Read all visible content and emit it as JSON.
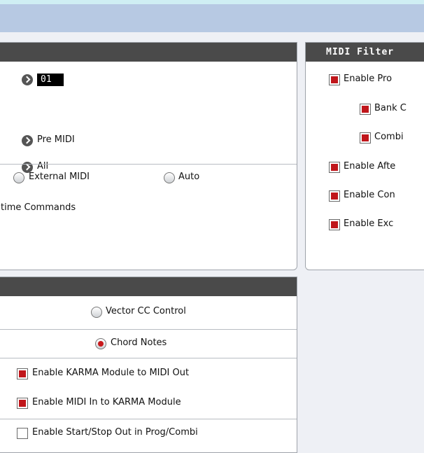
{
  "left_top_panel": {
    "channel_value": "01",
    "pre_midi_label": "Pre MIDI",
    "all_label": "All",
    "external_midi_label": "External MIDI",
    "auto_label": "Auto",
    "realtime_label": "time Commands"
  },
  "midi_filter": {
    "title": "MIDI Filter",
    "items": [
      {
        "label": "Enable Pro",
        "checked": true
      },
      {
        "label": "Bank C",
        "checked": true
      },
      {
        "label": "Combi",
        "checked": true
      },
      {
        "label": "Enable Afte",
        "checked": true
      },
      {
        "label": "Enable Con",
        "checked": true
      },
      {
        "label": "Enable Exc",
        "checked": true
      }
    ]
  },
  "karma_panel": {
    "vector_cc_label": "Vector CC Control",
    "chord_notes_label": "Chord Notes",
    "karma_to_midi_label": "Enable KARMA Module to MIDI Out",
    "midi_to_karma_label": "Enable MIDI In to KARMA Module",
    "start_stop_label": "Enable Start/Stop Out in Prog/Combi"
  },
  "colors": {
    "accent_red": "#c0161b",
    "header_bar": "#4a4a4a",
    "title_bar": "#b7c9e3"
  }
}
